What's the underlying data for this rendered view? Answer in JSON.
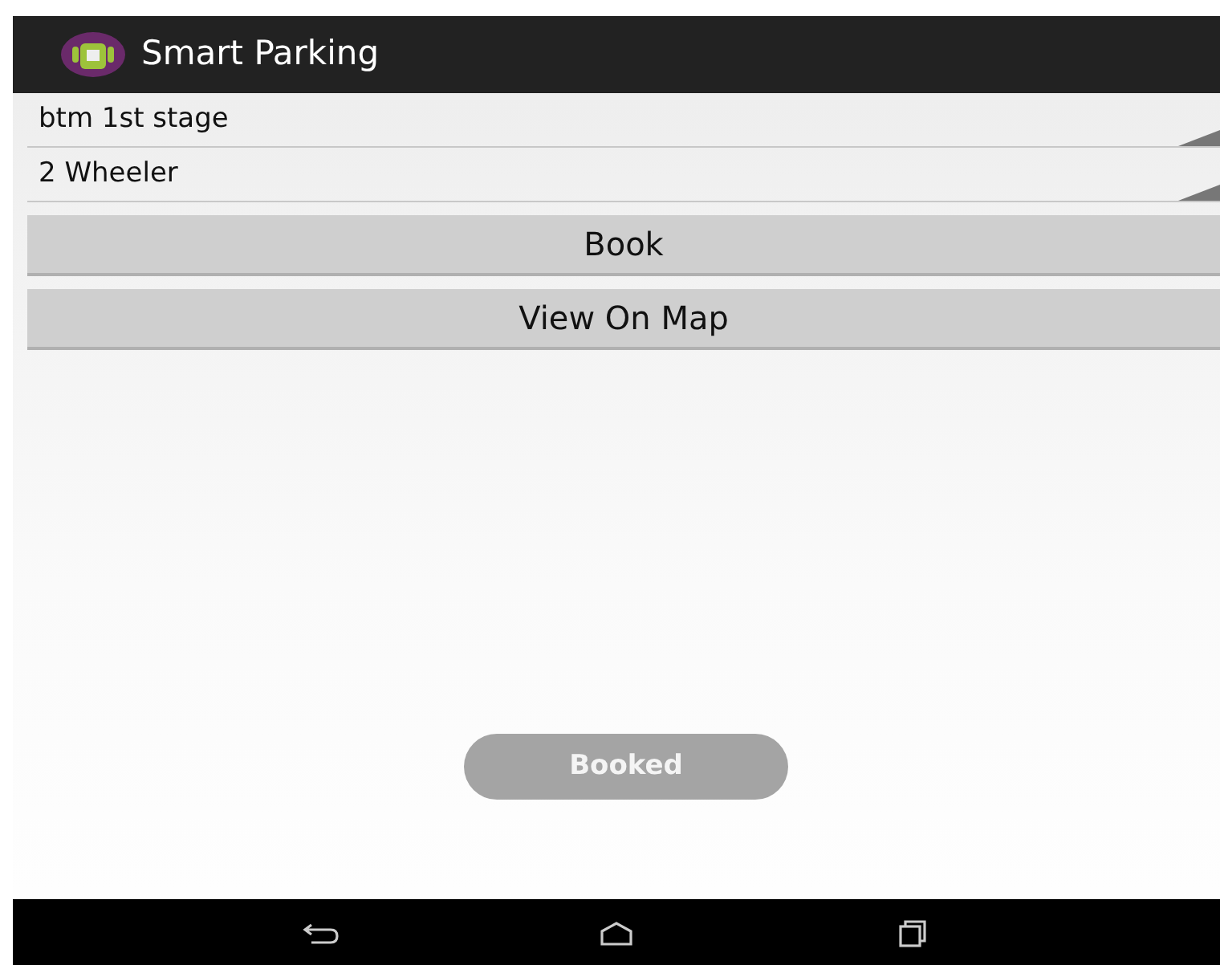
{
  "app_bar": {
    "title": "Smart Parking"
  },
  "spinners": [
    {
      "value": "btm 1st stage"
    },
    {
      "value": "2 Wheeler"
    }
  ],
  "buttons": [
    "Book",
    "View On Map"
  ],
  "toast": "Booked",
  "nav_bar": {
    "keys": [
      {
        "kind": "back"
      },
      {
        "kind": "home"
      },
      {
        "kind": "recents"
      }
    ]
  }
}
